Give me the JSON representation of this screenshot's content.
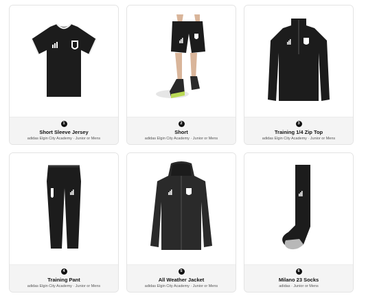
{
  "products": [
    {
      "number": "1",
      "name": "Short Sleeve Jersey",
      "subtitle": "adidas Elgin City Academy · Junior or Mens",
      "icon": "jersey-icon"
    },
    {
      "number": "2",
      "name": "Short",
      "subtitle": "adidas Elgin City Academy · Junior or Mens",
      "icon": "shorts-icon"
    },
    {
      "number": "3",
      "name": "Training 1/4 Zip Top",
      "subtitle": "adidas Elgin City Academy · Junior or Mens",
      "icon": "zip-top-icon"
    },
    {
      "number": "4",
      "name": "Training Pant",
      "subtitle": "adidas Elgin City Academy · Junior or Mens",
      "icon": "pant-icon"
    },
    {
      "number": "5",
      "name": "All Weather Jacket",
      "subtitle": "adidas Elgin City Academy · Junior or Mens",
      "icon": "jacket-icon"
    },
    {
      "number": "6",
      "name": "Milano 23 Socks",
      "subtitle": "adidas · Junior or Mens",
      "icon": "socks-icon"
    }
  ],
  "colors": {
    "garment": "#1c1c1c",
    "card_footer": "#f4f4f4",
    "sock_toe": "#b8b8b8"
  }
}
